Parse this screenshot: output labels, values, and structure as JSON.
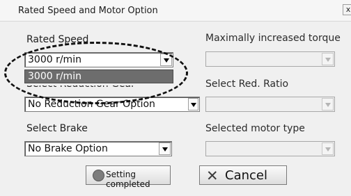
{
  "window": {
    "title": "Rated Speed and Motor Option",
    "close_glyph": "x"
  },
  "left": {
    "rated_speed_label": "Rated Speed",
    "rated_speed_value": "3000 r/min",
    "rated_speed_option": "3000 r/min",
    "reduction_gear_label": "Select Reduction Gear",
    "reduction_gear_value": "No Reduction Gear Option",
    "brake_label": "Select Brake",
    "brake_value": "No Brake Option"
  },
  "right": {
    "max_torque_label": "Maximally increased torque",
    "red_ratio_label": "Select Red. Ratio",
    "motor_type_label": "Selected motor type"
  },
  "buttons": {
    "ok_label": "Setting completed",
    "cancel_label": "Cancel"
  }
}
